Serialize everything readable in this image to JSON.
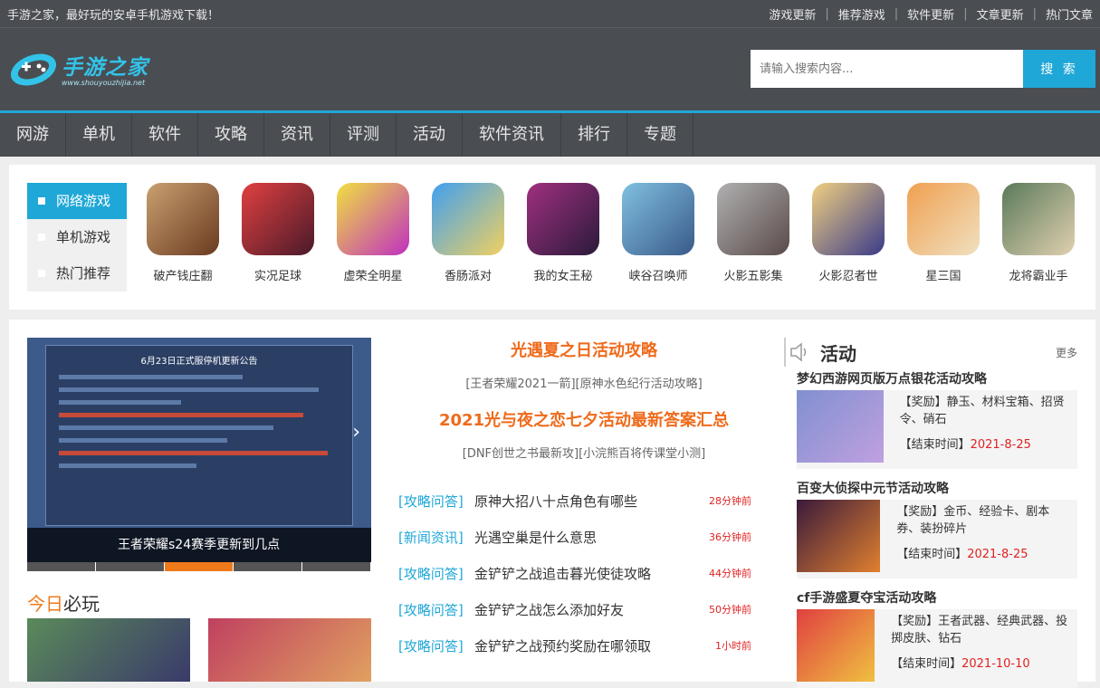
{
  "topbar": {
    "slogan": "手游之家，最好玩的安卓手机游戏下载！",
    "links": [
      "游戏更新",
      "推荐游戏",
      "软件更新",
      "文章更新",
      "热门文章"
    ]
  },
  "logo": {
    "title": "手游之家",
    "sub": "www.shouyouzhijia.net"
  },
  "search": {
    "placeholder": "请输入搜索内容...",
    "button": "搜 索"
  },
  "nav": [
    "网游",
    "单机",
    "软件",
    "攻略",
    "资讯",
    "评测",
    "活动",
    "软件资讯",
    "排行",
    "专题"
  ],
  "categories": [
    "网络游戏",
    "单机游戏",
    "热门推荐"
  ],
  "games": [
    {
      "name": "破产钱庄翻",
      "color": "#8a5a3a"
    },
    {
      "name": "实况足球",
      "color": "#b3262d"
    },
    {
      "name": "虚荣全明星",
      "color": "#d24cc4"
    },
    {
      "name": "香肠派对",
      "color": "#2a6ad0"
    },
    {
      "name": "我的女王秘",
      "color": "#6a2a6a"
    },
    {
      "name": "峡谷召唤师",
      "color": "#4a8ab8"
    },
    {
      "name": "火影五影集",
      "color": "#6a6a6a"
    },
    {
      "name": "火影忍者世",
      "color": "#e0b040"
    },
    {
      "name": "星三国",
      "color": "#e08a40"
    },
    {
      "name": "龙将霸业手",
      "color": "#3a5a3a"
    }
  ],
  "banner": {
    "panel_title": "6月23日正式服停机更新公告",
    "caption": "王者荣耀s24赛季更新到几点"
  },
  "today": {
    "highlight": "今日",
    "rest": "必玩"
  },
  "headlines": [
    {
      "title": "光遇夏之日活动攻略",
      "sub": "[王者荣耀2021一箭][原神水色纪行活动攻略]"
    },
    {
      "title": "2021光与夜之恋七夕活动最新答案汇总",
      "sub": "[DNF创世之书最新攻][小浣熊百将传课堂小测]"
    }
  ],
  "news": [
    {
      "tag": "[攻略问答]",
      "title": "原神大招八十点角色有哪些",
      "time": "28分钟前"
    },
    {
      "tag": "[新闻资讯]",
      "title": "光遇空巢是什么意思",
      "time": "36分钟前"
    },
    {
      "tag": "[攻略问答]",
      "title": "金铲铲之战追击暮光使徒攻略",
      "time": "44分钟前"
    },
    {
      "tag": "[攻略问答]",
      "title": "金铲铲之战怎么添加好友",
      "time": "50分钟前"
    },
    {
      "tag": "[攻略问答]",
      "title": "金铲铲之战预约奖励在哪领取",
      "time": "1小时前"
    }
  ],
  "side": {
    "title": "活动",
    "more": "更多",
    "reward_label": "【奖励】",
    "end_label": "【结束时间】",
    "items": [
      {
        "title": "梦幻西游网页版万点银花活动攻略",
        "reward": "静玉、材料宝箱、招贤令、硝石",
        "end": "2021-8-25"
      },
      {
        "title": "百变大侦探中元节活动攻略",
        "reward": "金币、经验卡、剧本券、装扮碎片",
        "end": "2021-8-25"
      },
      {
        "title": "cf手游盛夏夺宝活动攻略",
        "reward": "王者武器、经典武器、投掷皮肤、钻石",
        "end": "2021-10-10"
      }
    ]
  }
}
